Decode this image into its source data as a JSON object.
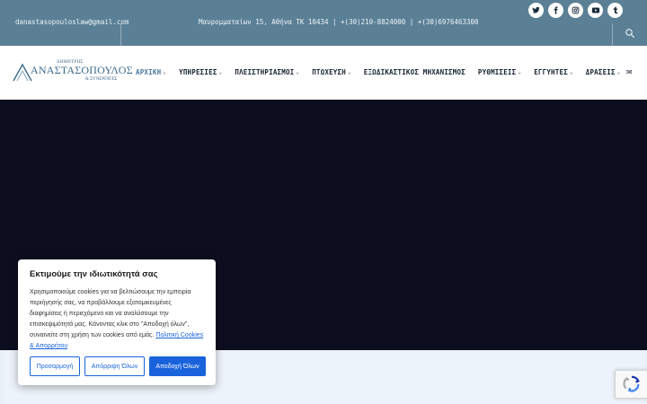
{
  "topbar": {
    "email": "danastasopouloslaw@gmail.com",
    "address": "Μαυρομματαίων 15, Αθήνα ΤΚ 10434 | +(30)210-8824000 | +(30)6976463300",
    "social": [
      {
        "icon": "twitter-icon",
        "glyph": "🐦"
      },
      {
        "icon": "facebook-icon",
        "glyph": "f"
      },
      {
        "icon": "instagram-icon",
        "glyph": "◎"
      },
      {
        "icon": "youtube-icon",
        "glyph": "▶"
      },
      {
        "icon": "tumblr-icon",
        "glyph": "t"
      }
    ]
  },
  "logo": {
    "small": "ΔΗΜΗΤΡΗΣ",
    "big": "ΑΝΑΣΤΑΣΟΠΟΥΛΟΣ",
    "sub": "& ΣΥΝΕΡΓΑΤΕΣ"
  },
  "menu": [
    {
      "label": "ΑΡΧΙΚΗ",
      "dropdown": true,
      "active": true
    },
    {
      "label": "ΥΠΗΡΕΣΙΕΣ",
      "dropdown": true
    },
    {
      "label": "ΠΛΕΙΣΤΗΡΙΑΣΜΟΙ",
      "dropdown": true
    },
    {
      "label": "ΠΤΩΧΕΥΣΗ",
      "dropdown": true
    },
    {
      "label": "ΕΞΩΔΙΚΑΣΤΙΚΟΣ ΜΗΧΑΝΙΣΜΟΣ",
      "dropdown": false
    },
    {
      "label": "ΡΥΘΜΙΣΕΙΣ",
      "dropdown": true
    },
    {
      "label": "ΕΓΓΥΗΤΕΣ",
      "dropdown": true
    },
    {
      "label": "ΔΡΑΣΕΙΣ",
      "dropdown": true
    }
  ],
  "cookie": {
    "title": "Εκτιμούμε την ιδιωτικότητά σας",
    "text": "Χρησιμοποιούμε cookies για να βελτιώσουμε την εμπειρία περιήγησής σας, να προβάλλουμε εξατομικευμένες διαφημίσεις ή περιεχόμενο και να αναλύσουμε την επισκεψιμότητά μας. Κάνοντας κλικ στο \"Αποδοχή όλων\", συναινείτε στη χρήση των cookies από εμάς.",
    "link": "Πολιτική Cookies & Απορρήτου",
    "customize": "Προσαρμογή",
    "reject": "Απόρριψη Όλων",
    "accept": "Αποδοχή Όλων"
  },
  "colors": {
    "topbar": "#5b8096",
    "hero": "#0c0d1f",
    "accent": "#1863dc",
    "active_menu": "#4a78a0"
  }
}
